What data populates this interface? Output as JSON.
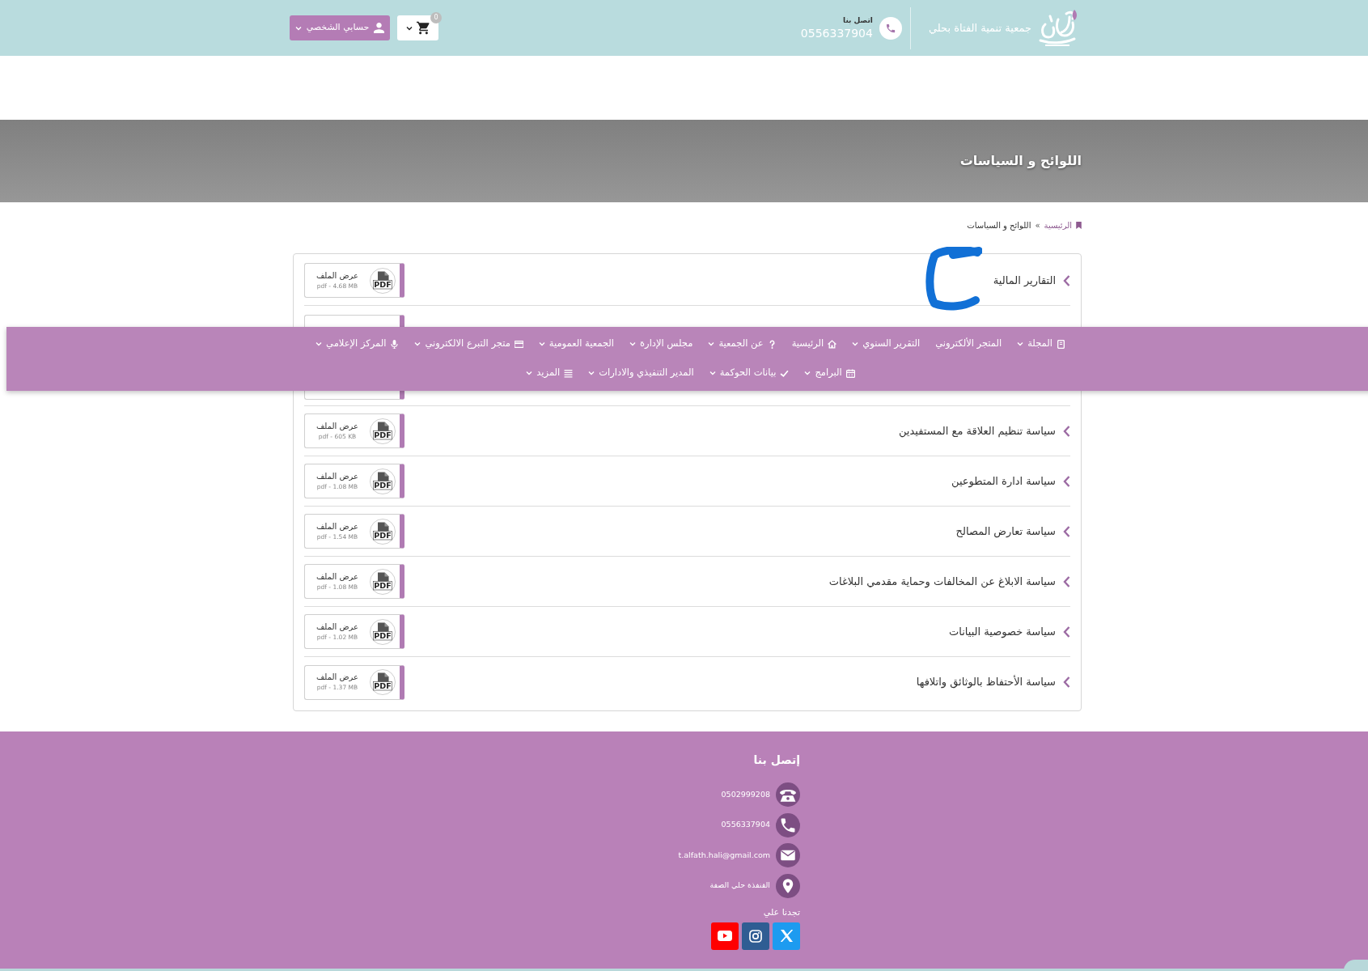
{
  "header": {
    "org_name": "جمعية تنمية الفتاة بحلي",
    "contact_label": "اتصل بنا",
    "contact_phone": "0556337904",
    "cart_count": "0",
    "account_label": "حسابي الشخصي"
  },
  "nav": {
    "rows": [
      {
        "items": [
          {
            "label": "المجلة",
            "submenu": true
          },
          {
            "label": "المتجر الألكتروني",
            "submenu": false
          },
          {
            "label": "التقرير السنوي",
            "submenu": true
          },
          {
            "label": "الرئيسية",
            "submenu": false
          },
          {
            "label": "عن الجمعية",
            "submenu": true
          },
          {
            "label": "مجلس الإدارة",
            "submenu": true
          },
          {
            "label": "الجمعية العمومية",
            "submenu": true
          },
          {
            "label": "متجر التبرع الالكتروني",
            "submenu": true
          },
          {
            "label": "المركز الإعلامي",
            "submenu": true
          }
        ]
      },
      {
        "items": [
          {
            "label": "البرامج",
            "submenu": true
          },
          {
            "label": "بيانات الحوكمة",
            "submenu": true
          },
          {
            "label": "المدير التنفيذي والادارات",
            "submenu": true
          },
          {
            "label": "المزيد",
            "submenu": true
          }
        ]
      }
    ]
  },
  "banner": {
    "title": "اللوائح و السياسات"
  },
  "breadcrumb": {
    "home": "الرئيسية",
    "separator": "»",
    "current": "اللوائح و السياسات"
  },
  "documents": [
    {
      "kind": "full",
      "title": "التقارير المالية",
      "action": "عرض الملف",
      "file_type": "PDF",
      "file_info": "pdf - 4.68 MB"
    },
    {
      "kind": "top"
    },
    {
      "kind": "bottom"
    },
    {
      "kind": "full",
      "title": "سياسة تنظيم العلاقة مع المستفيدين",
      "action": "عرض الملف",
      "file_type": "PDF",
      "file_info": "pdf - 605 KB"
    },
    {
      "kind": "full",
      "title": "سياسة ادارة المتطوعين",
      "action": "عرض الملف",
      "file_type": "PDF",
      "file_info": "pdf - 1.08 MB"
    },
    {
      "kind": "full",
      "title": "سياسة تعارض المصالح",
      "action": "عرض الملف",
      "file_type": "PDF",
      "file_info": "pdf - 1.54 MB"
    },
    {
      "kind": "full",
      "title": "سياسة الابلاغ عن المخالفات وحماية مقدمي البلاغات",
      "action": "عرض الملف",
      "file_type": "PDF",
      "file_info": "pdf - 1.08 MB"
    },
    {
      "kind": "full",
      "title": "سياسة خصوصية البيانات",
      "action": "عرض الملف",
      "file_type": "PDF",
      "file_info": "pdf - 1.02 MB"
    },
    {
      "kind": "full",
      "title": "سياسة الأحتفاظ بالوثائق واتلافها",
      "action": "عرض الملف",
      "file_type": "PDF",
      "file_info": "pdf - 1.37 MB"
    }
  ],
  "footer": {
    "title": "إتصل بنا",
    "contacts": [
      {
        "text": "0502999208"
      },
      {
        "text": "0556337904"
      },
      {
        "text": "t.alfath.hali@gmail.com"
      },
      {
        "text": "القنفذة حلي الصفة"
      }
    ],
    "social_title": "تجدنا علي"
  }
}
